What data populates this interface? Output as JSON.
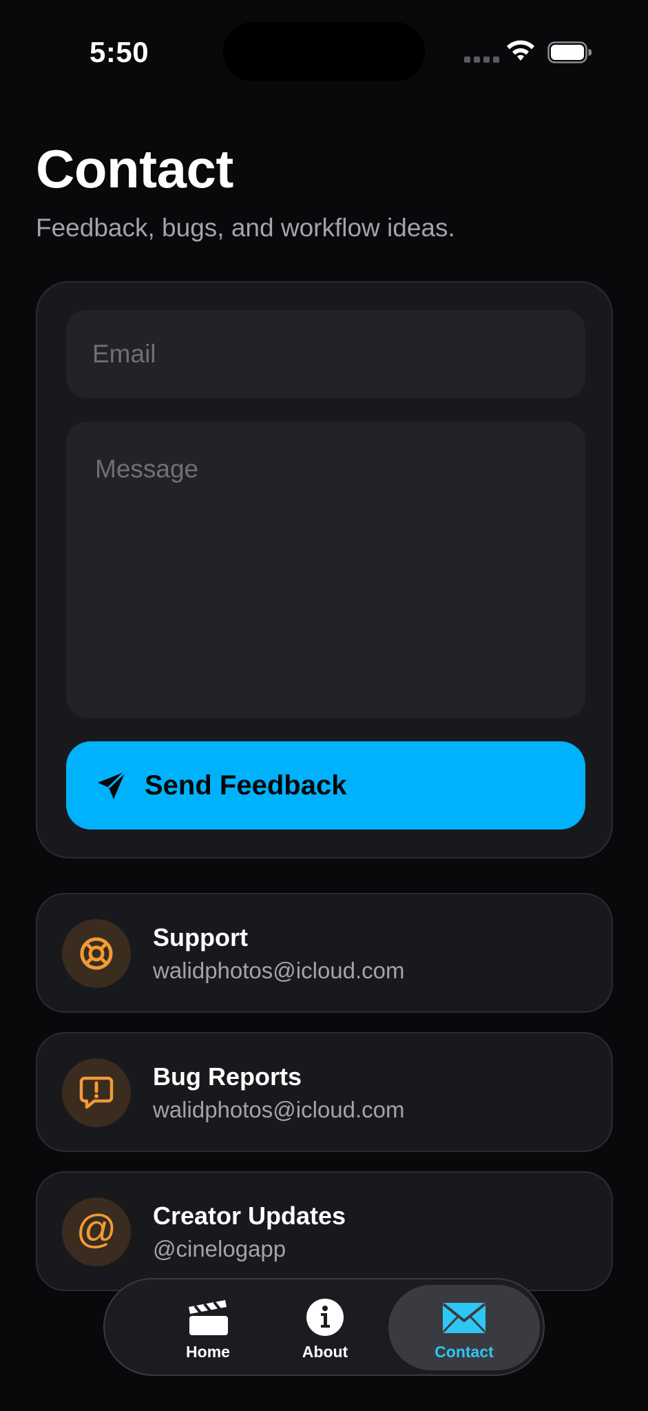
{
  "status_bar": {
    "time": "5:50"
  },
  "header": {
    "title": "Contact",
    "subtitle": "Feedback, bugs, and workflow ideas."
  },
  "form": {
    "email_placeholder": "Email",
    "email_value": "",
    "message_placeholder": "Message",
    "message_value": "",
    "send_label": "Send Feedback",
    "send_icon": "paperplane-icon"
  },
  "contacts": [
    {
      "title": "Support",
      "detail": "walidphotos@icloud.com",
      "icon": "lifebuoy-icon"
    },
    {
      "title": "Bug Reports",
      "detail": "walidphotos@icloud.com",
      "icon": "exclamation-bubble-icon"
    },
    {
      "title": "Creator Updates",
      "detail": "@cinelogapp",
      "icon": "at-sign-icon",
      "icon_glyph": "@"
    }
  ],
  "tabs": [
    {
      "label": "Home",
      "icon": "clapperboard-icon",
      "active": false
    },
    {
      "label": "About",
      "icon": "info-circle-icon",
      "active": false
    },
    {
      "label": "Contact",
      "icon": "envelope-icon",
      "active": true
    }
  ],
  "colors": {
    "background": "#08090b",
    "card": "#18191c",
    "accent": "#00b2fb",
    "icon_orange": "#f29a36",
    "active_tab_text": "#2ec6f4"
  }
}
